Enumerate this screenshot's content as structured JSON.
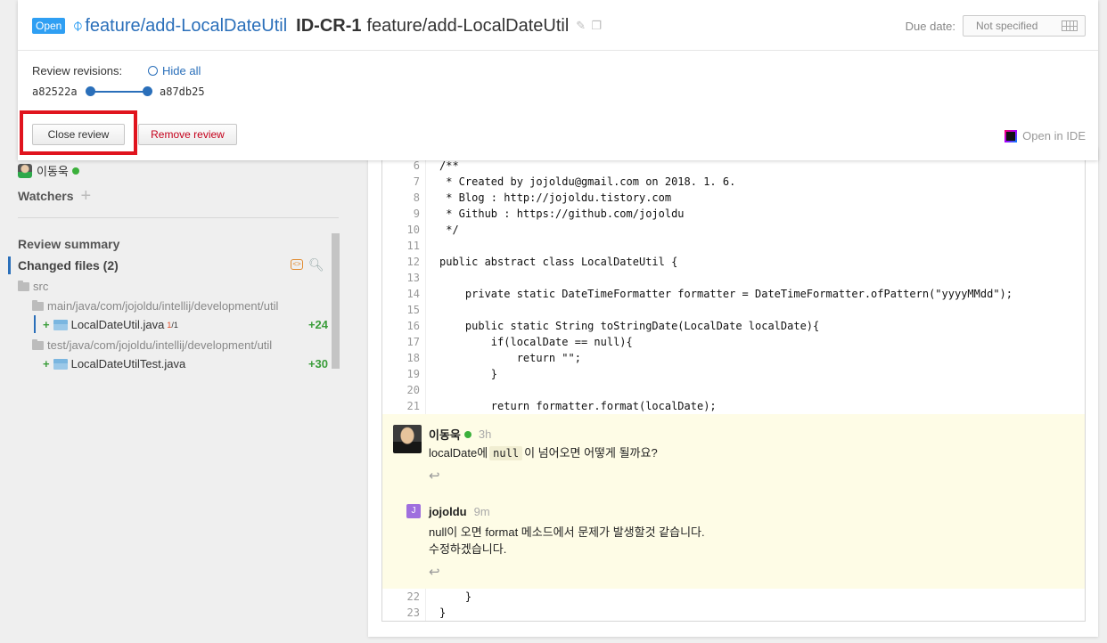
{
  "header": {
    "status_badge": "Open",
    "branch": "feature/add-LocalDateUtil",
    "review_id": "ID-CR-1",
    "review_title": "feature/add-LocalDateUtil",
    "due_label": "Due date:",
    "due_value": "Not specified",
    "revisions_label": "Review revisions:",
    "hide_all": "Hide all",
    "rev_from": "a82522a",
    "rev_to": "a87db25",
    "close_review": "Close review",
    "remove_review": "Remove review",
    "open_in_ide": "Open in IDE"
  },
  "sidebar": {
    "participant": "이동욱",
    "watchers_label": "Watchers",
    "review_summary": "Review summary",
    "changed_files": "Changed files (2)",
    "folders": {
      "root": "src",
      "main": "main/java/com/jojoldu/intellij/development/util",
      "test": "test/java/com/jojoldu/intellij/development/util"
    },
    "files": [
      {
        "plus": "+",
        "name": "LocalDateUtil.java",
        "comment_count": "1",
        "comment_sep": "/",
        "comment_total": "1",
        "delta": "+24"
      },
      {
        "plus": "+",
        "name": "LocalDateUtilTest.java",
        "delta": "+30"
      }
    ]
  },
  "code": {
    "lines_top": [
      {
        "n": "6",
        "t": "/**"
      },
      {
        "n": "7",
        "t": " * Created by jojoldu@gmail.com on 2018. 1. 6."
      },
      {
        "n": "8",
        "t": " * Blog : http://jojoldu.tistory.com"
      },
      {
        "n": "9",
        "t": " * Github : https://github.com/jojoldu"
      },
      {
        "n": "10",
        "t": " */"
      },
      {
        "n": "11",
        "t": ""
      },
      {
        "n": "12",
        "t": "public abstract class LocalDateUtil {"
      },
      {
        "n": "13",
        "t": ""
      },
      {
        "n": "14",
        "t": "    private static DateTimeFormatter formatter = DateTimeFormatter.ofPattern(\"yyyyMMdd\");"
      },
      {
        "n": "15",
        "t": ""
      },
      {
        "n": "16",
        "t": "    public static String toStringDate(LocalDate localDate){"
      },
      {
        "n": "17",
        "t": "        if(localDate == null){"
      },
      {
        "n": "18",
        "t": "            return \"\";"
      },
      {
        "n": "19",
        "t": "        }"
      },
      {
        "n": "20",
        "t": ""
      },
      {
        "n": "21",
        "t": "        return formatter.format(localDate);"
      }
    ],
    "lines_bottom": [
      {
        "n": "22",
        "t": "    }"
      },
      {
        "n": "23",
        "t": "}"
      }
    ]
  },
  "thread": {
    "first": {
      "author": "이동욱",
      "time": "3h",
      "text_before": "localDate에",
      "code": "null",
      "text_after": "이 넘어오면 어떻게 될까요?"
    },
    "second": {
      "avatar_letter": "J",
      "author": "jojoldu",
      "time": "9m",
      "line1": "null이 오면 format 메소드에서 문제가 발생할것 같습니다.",
      "line2": "수정하겠습니다."
    }
  },
  "colors": {
    "accent": "#2a6fba",
    "badge": "#2f9ff3",
    "highlight_frame": "#e0141e",
    "added": "#3a9d3a",
    "comment_bg": "#fefce6"
  }
}
